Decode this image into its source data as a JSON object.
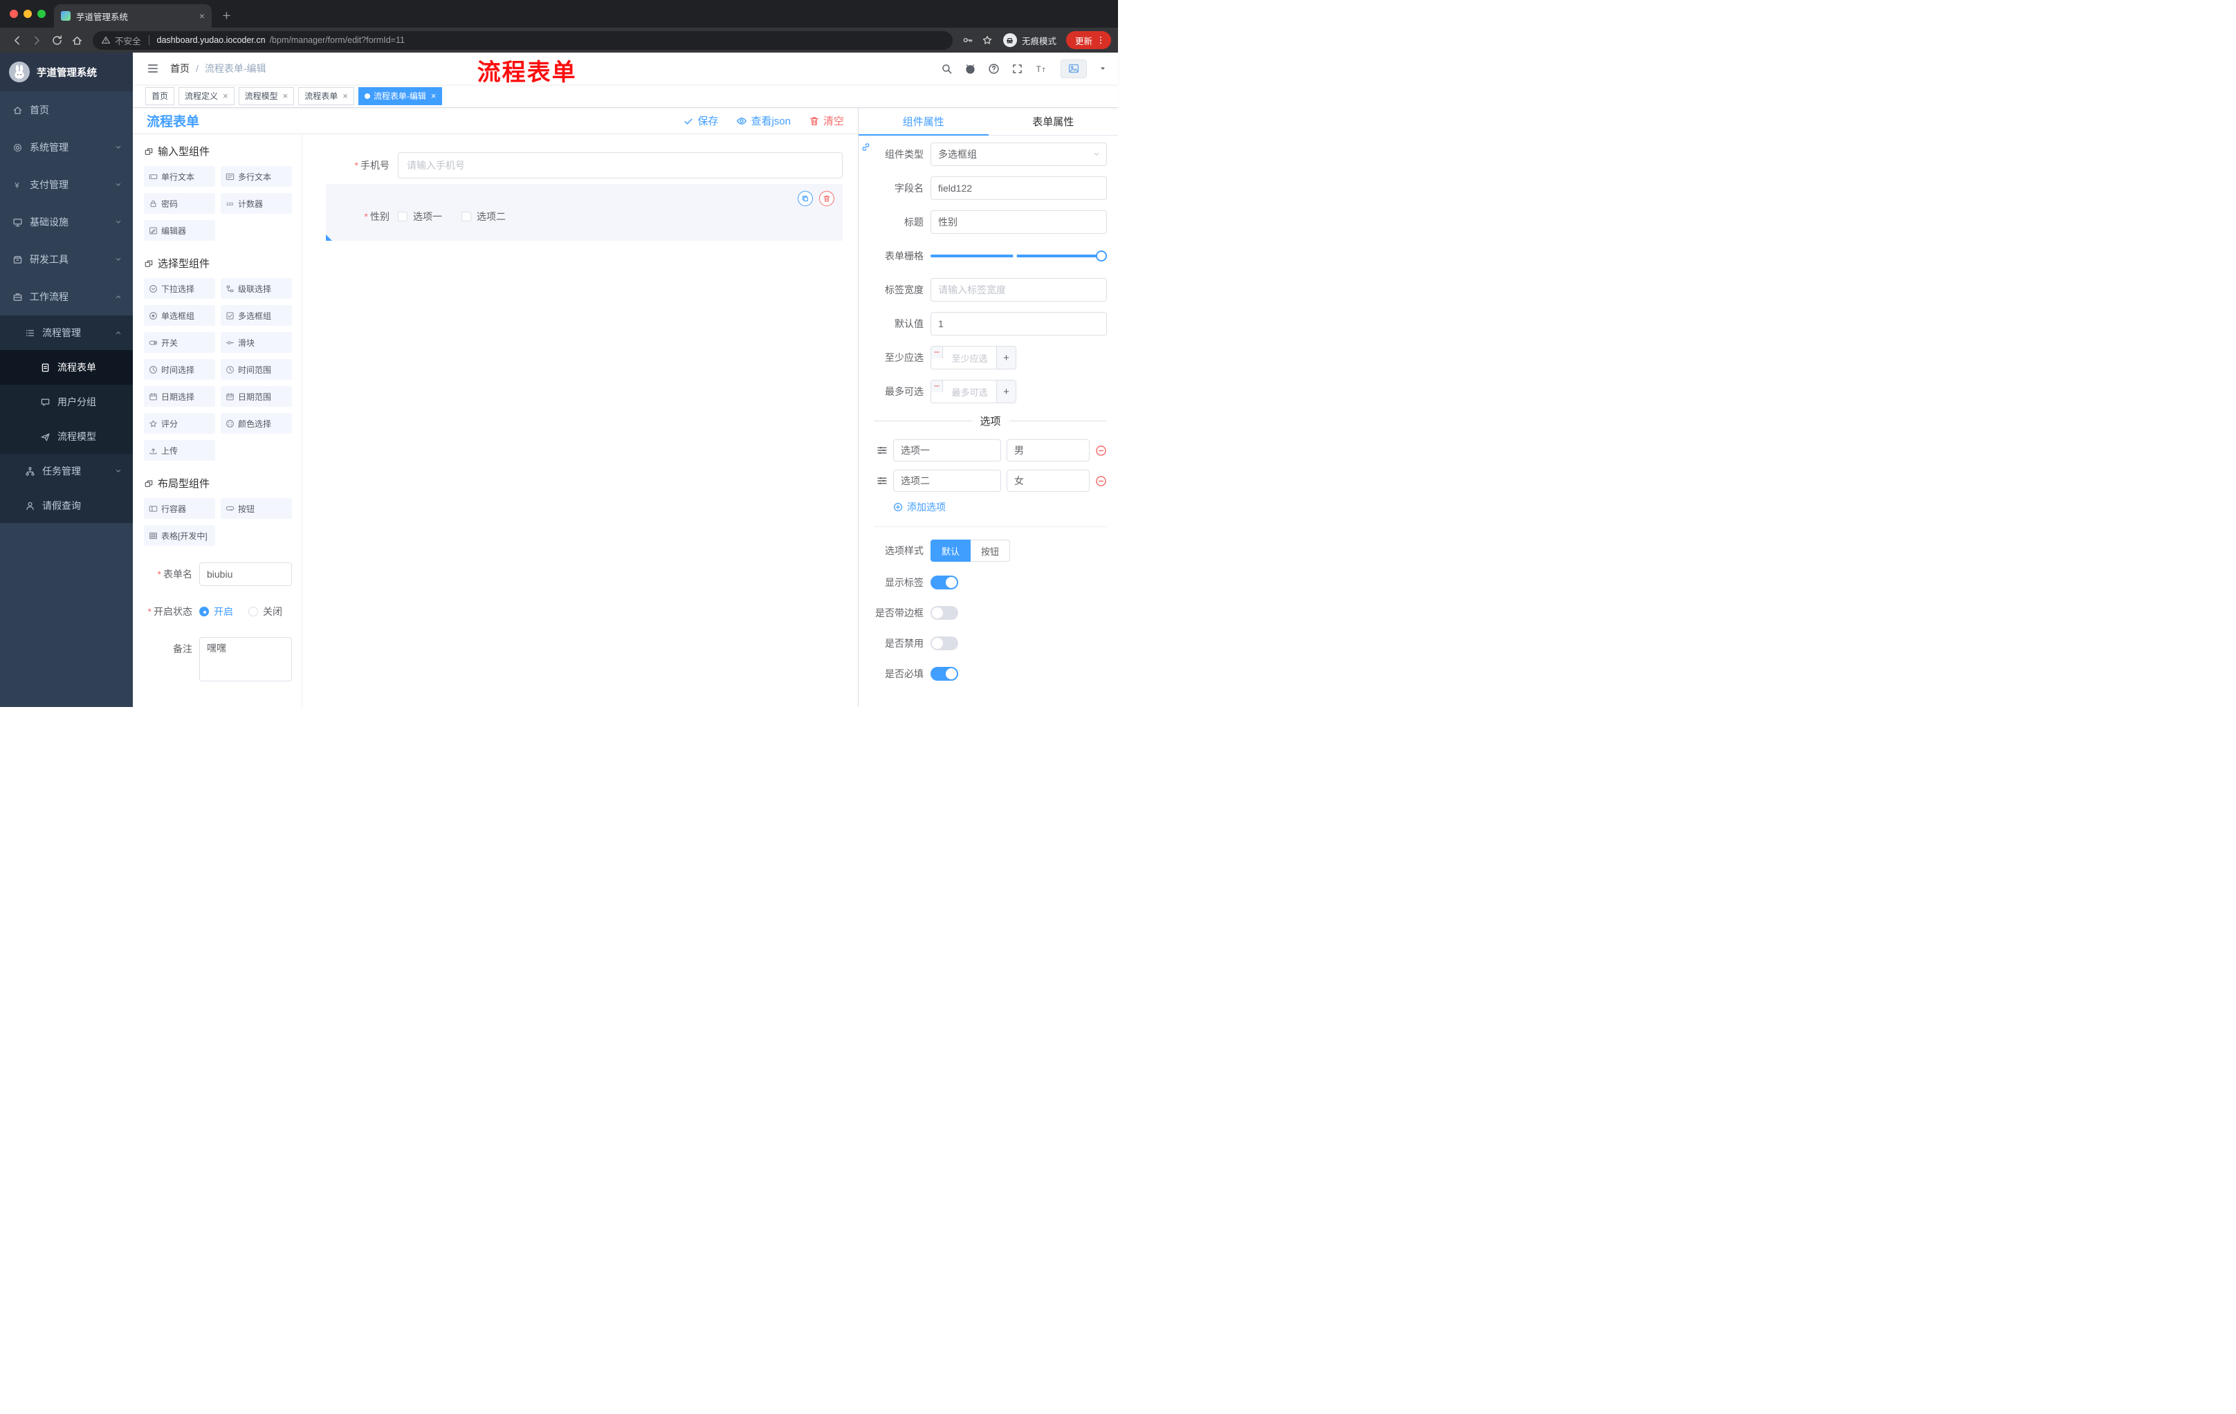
{
  "browser": {
    "tab_title": "芋道管理系统",
    "security_label": "不安全",
    "url_domain": "dashboard.yudao.iocoder.cn",
    "url_path": "/bpm/manager/form/edit?formId=11",
    "incognito_label": "无痕模式",
    "update_label": "更新"
  },
  "header": {
    "breadcrumb": [
      "首页",
      "流程表单-编辑"
    ],
    "annotation": "流程表单"
  },
  "sidebar": {
    "logo_title": "芋道管理系统",
    "items": [
      {
        "label": "首页",
        "icon": "home",
        "level": 1
      },
      {
        "label": "系统管理",
        "icon": "gear",
        "level": 1,
        "arrow": "down"
      },
      {
        "label": "支付管理",
        "icon": "yen",
        "level": 1,
        "arrow": "down"
      },
      {
        "label": "基础设施",
        "icon": "infra",
        "level": 1,
        "arrow": "down"
      },
      {
        "label": "研发工具",
        "icon": "tools",
        "level": 1,
        "arrow": "down"
      },
      {
        "label": "工作流程",
        "icon": "workflow",
        "level": 1,
        "arrow": "up"
      },
      {
        "label": "流程管理",
        "icon": "list",
        "level": 2,
        "arrow": "up"
      },
      {
        "label": "流程表单",
        "icon": "doc",
        "level": 3,
        "active": true
      },
      {
        "label": "用户分组",
        "icon": "chat",
        "level": 3
      },
      {
        "label": "流程模型",
        "icon": "send",
        "level": 3
      },
      {
        "label": "任务管理",
        "icon": "tree",
        "level": 2,
        "arrow": "down"
      },
      {
        "label": "请假查询",
        "icon": "user",
        "level": 2
      }
    ]
  },
  "tags": [
    {
      "label": "首页"
    },
    {
      "label": "流程定义",
      "closable": true
    },
    {
      "label": "流程模型",
      "closable": true
    },
    {
      "label": "流程表单",
      "closable": true
    },
    {
      "label": "流程表单-编辑",
      "closable": true,
      "active": true
    }
  ],
  "toolbar": {
    "title": "流程表单",
    "save": "保存",
    "view_json": "查看json",
    "clear": "清空"
  },
  "components": {
    "groups": [
      {
        "title": "输入型组件",
        "items": [
          {
            "label": "单行文本",
            "icon": "input"
          },
          {
            "label": "多行文本",
            "icon": "textarea"
          },
          {
            "label": "密码",
            "icon": "lock"
          },
          {
            "label": "计数器",
            "icon": "counter"
          },
          {
            "label": "编辑器",
            "icon": "editor"
          }
        ]
      },
      {
        "title": "选择型组件",
        "items": [
          {
            "label": "下拉选择",
            "icon": "select"
          },
          {
            "label": "级联选择",
            "icon": "cascader"
          },
          {
            "label": "单选框组",
            "icon": "radio"
          },
          {
            "label": "多选框组",
            "icon": "checkbox"
          },
          {
            "label": "开关",
            "icon": "switch"
          },
          {
            "label": "滑块",
            "icon": "slider"
          },
          {
            "label": "时间选择",
            "icon": "time"
          },
          {
            "label": "时间范围",
            "icon": "time-range"
          },
          {
            "label": "日期选择",
            "icon": "date"
          },
          {
            "label": "日期范围",
            "icon": "date-range"
          },
          {
            "label": "评分",
            "icon": "rate"
          },
          {
            "label": "颜色选择",
            "icon": "color"
          },
          {
            "label": "上传",
            "icon": "upload"
          }
        ]
      },
      {
        "title": "布局型组件",
        "items": [
          {
            "label": "行容器",
            "icon": "row"
          },
          {
            "label": "按钮",
            "icon": "button"
          },
          {
            "label": "表格[开发中]",
            "icon": "table"
          }
        ]
      }
    ],
    "form": {
      "name_label": "表单名",
      "name_value": "biubiu",
      "status_label": "开启状态",
      "status_on": "开启",
      "status_off": "关闭",
      "remark_label": "备注",
      "remark_value": "嘿嘿"
    }
  },
  "canvas": {
    "phone": {
      "label": "手机号",
      "placeholder": "请输入手机号"
    },
    "gender": {
      "label": "性别",
      "options": [
        "选项一",
        "选项二"
      ]
    }
  },
  "props": {
    "tabs": [
      "组件属性",
      "表单属性"
    ],
    "fields": {
      "type_label": "组件类型",
      "type_value": "多选框组",
      "field_label": "字段名",
      "field_value": "field122",
      "title_label": "标题",
      "title_value": "性别",
      "grid_label": "表单栅格",
      "width_label": "标签宽度",
      "width_placeholder": "请输入标签宽度",
      "default_label": "默认值",
      "default_value": "1",
      "min_label": "至少应选",
      "min_placeholder": "至少应选",
      "max_label": "最多可选",
      "max_placeholder": "最多可选"
    },
    "options_divider": "选项",
    "options": [
      {
        "label": "选项一",
        "value": "男"
      },
      {
        "label": "选项二",
        "value": "女"
      }
    ],
    "add_option": "添加选项",
    "style_label": "选项样式",
    "style_options": [
      {
        "label": "默认",
        "active": true
      },
      {
        "label": "按钮",
        "active": false
      }
    ],
    "switches": [
      {
        "label": "显示标签",
        "on": true
      },
      {
        "label": "是否带边框",
        "on": false
      },
      {
        "label": "是否禁用",
        "on": false
      },
      {
        "label": "是否必填",
        "on": true
      }
    ]
  },
  "colors": {
    "accent": "#409eff",
    "danger": "#f56c6c",
    "annotation": "#fb0e0e"
  }
}
